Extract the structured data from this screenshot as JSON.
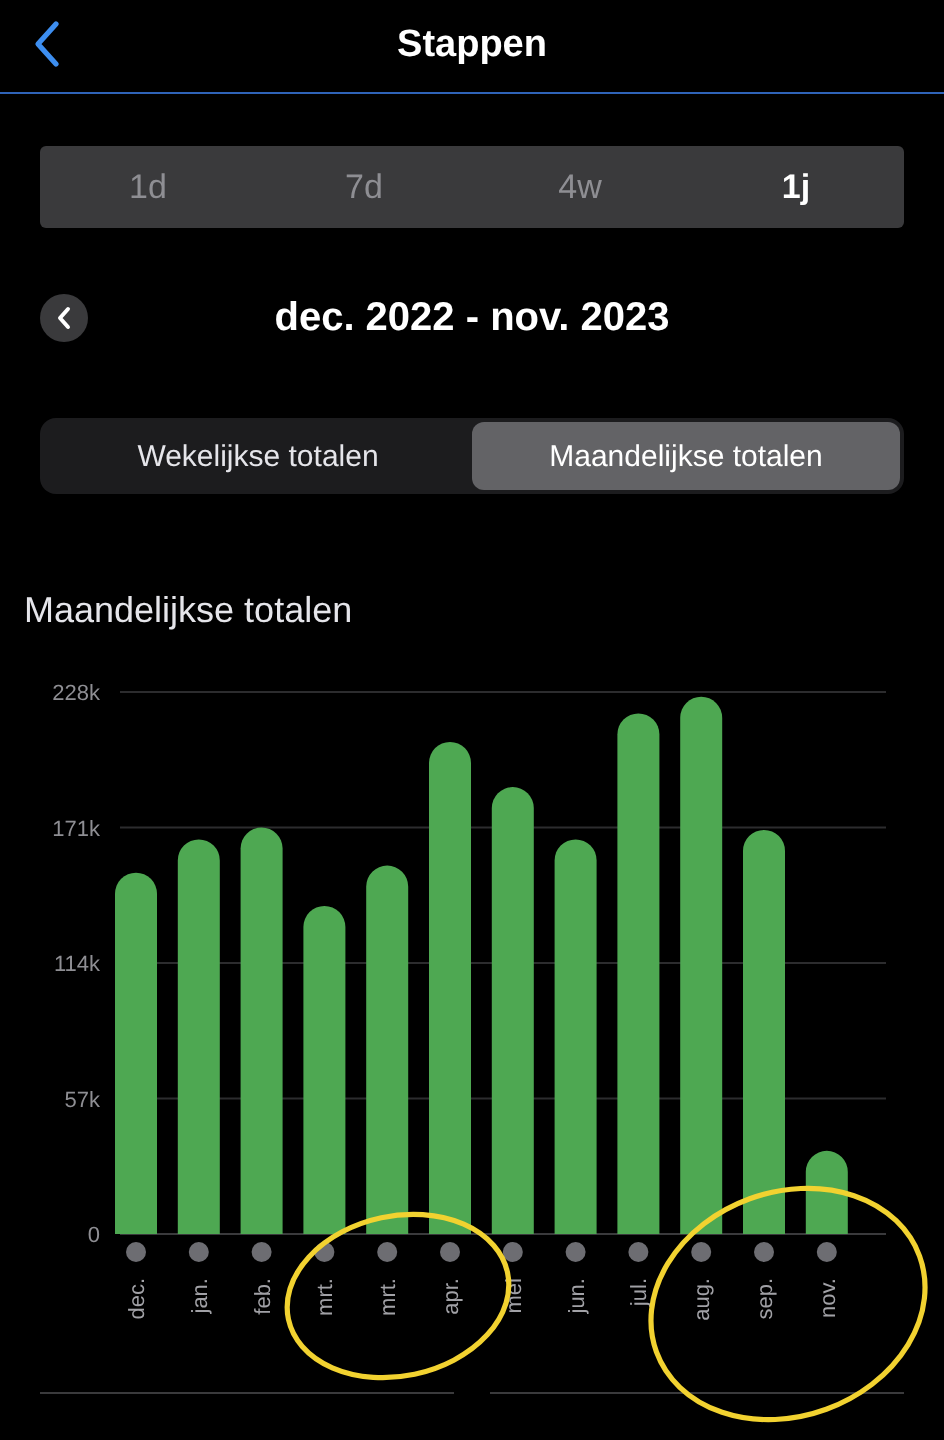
{
  "header": {
    "title": "Stappen"
  },
  "ranges": [
    {
      "label": "1d",
      "selected": false
    },
    {
      "label": "7d",
      "selected": false
    },
    {
      "label": "4w",
      "selected": false
    },
    {
      "label": "1j",
      "selected": true
    }
  ],
  "period": {
    "label": "dec. 2022 - nov. 2023"
  },
  "totals_toggle": [
    {
      "label": "Wekelijkse totalen",
      "selected": false
    },
    {
      "label": "Maandelijkse totalen",
      "selected": true
    }
  ],
  "section_title": "Maandelijkse totalen",
  "chart_data": {
    "type": "bar",
    "categories": [
      "dec.",
      "jan.",
      "feb.",
      "mrt.",
      "mrt.",
      "apr.",
      "mei",
      "jun.",
      "jul.",
      "aug.",
      "sep.",
      "nov."
    ],
    "grid": true,
    "series": [
      {
        "color": "#4ea852",
        "values": [
          152000,
          166000,
          171000,
          138000,
          155000,
          207000,
          188000,
          166000,
          219000,
          226000,
          170000,
          35000
        ]
      }
    ],
    "ylim": [
      0,
      228000
    ],
    "yticks": [
      {
        "value": 0,
        "label": "0"
      },
      {
        "value": 57000,
        "label": "57k"
      },
      {
        "value": 114000,
        "label": "114k"
      },
      {
        "value": 171000,
        "label": "171k"
      },
      {
        "value": 228000,
        "label": "228k"
      }
    ]
  },
  "hand_drawn_marks": [
    {
      "kind": "ellipse",
      "color": "#f2d230"
    },
    {
      "kind": "ellipse",
      "color": "#f2d230"
    }
  ]
}
